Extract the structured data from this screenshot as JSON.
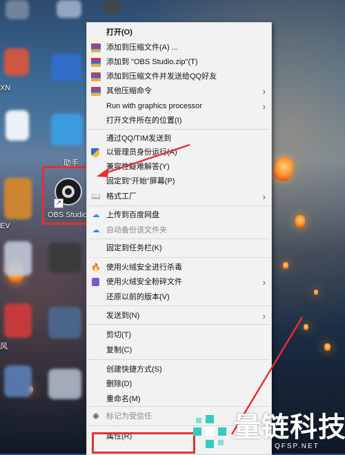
{
  "desktop": {
    "obs_icon_label": "OBS Studio",
    "partial_labels": {
      "helper": "助手",
      "left_xn": "XN",
      "left_ev": "EV",
      "left_feng": "风"
    }
  },
  "context_menu": {
    "items": [
      {
        "label": "打开(O)",
        "icon": "none",
        "bold": true
      },
      {
        "label": "添加到压缩文件(A) ...",
        "icon": "winrar-archive-icon"
      },
      {
        "label": "添加到 \"OBS Studio.zip\"(T)",
        "icon": "winrar-archive-icon"
      },
      {
        "label": "添加到压缩文件并发送给QQ好友",
        "icon": "winrar-archive-icon"
      },
      {
        "label": "其他压缩命令",
        "icon": "winrar-archive-icon",
        "submenu": true
      },
      {
        "label": "Run with graphics processor",
        "icon": "none",
        "submenu": true
      },
      {
        "label": "打开文件所在的位置(I)",
        "icon": "none"
      },
      {
        "label": "通过QQ/TIM发送到",
        "icon": "none"
      },
      {
        "label": "以管理员身份运行(A)",
        "icon": "uac-shield-icon"
      },
      {
        "label": "兼容性疑难解答(Y)",
        "icon": "none"
      },
      {
        "label": "固定到\"开始\"屏幕(P)",
        "icon": "none"
      },
      {
        "label": "格式工厂",
        "icon": "format-factory-icon",
        "submenu": true
      },
      {
        "label": "上传到百度网盘",
        "icon": "baidu-cloud-icon"
      },
      {
        "label": "自动备份该文件夹",
        "icon": "baidu-cloud-icon",
        "disabled": true
      },
      {
        "label": "固定到任务栏(K)",
        "icon": "none"
      },
      {
        "label": "使用火绒安全进行杀毒",
        "icon": "huorong-flame-icon"
      },
      {
        "label": "使用火绒安全粉碎文件",
        "icon": "shredder-icon",
        "submenu": true
      },
      {
        "label": "还原以前的版本(V)",
        "icon": "none"
      },
      {
        "label": "发送到(N)",
        "icon": "none",
        "submenu": true
      },
      {
        "label": "剪切(T)",
        "icon": "none"
      },
      {
        "label": "复制(C)",
        "icon": "none"
      },
      {
        "label": "创建快捷方式(S)",
        "icon": "none"
      },
      {
        "label": "删除(D)",
        "icon": "none"
      },
      {
        "label": "重命名(M)",
        "icon": "none"
      },
      {
        "label": "标记为受信任",
        "icon": "trust-icon",
        "disabled": true
      },
      {
        "label": "属性(R)",
        "icon": "none"
      }
    ],
    "submenu_arrow": "›"
  },
  "watermark": {
    "brand": "量链科技",
    "domain": "QFSP.NET"
  },
  "colors": {
    "annotation_red": "#e53030",
    "menu_bg": "#f2f2f2",
    "accent_blue": "#2f8de8"
  }
}
